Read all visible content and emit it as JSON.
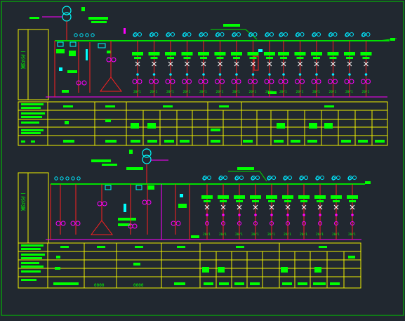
{
  "drawing": {
    "title": "",
    "colors": {
      "background": "#212830",
      "bus": "#00e000",
      "feeder": "#ff2020",
      "table_grid": "#f0f000",
      "label": "#00ff00",
      "breaker": "#ff00ff",
      "instrument": "#00e8ff",
      "transformer": "#00ffff",
      "border": "#00cc00",
      "white": "#ffffff"
    },
    "top_panel": {
      "side_label": "一次方案",
      "feeder_tag": "20/1",
      "feeder_count_left": 9,
      "feeder_count_right": 6
    },
    "bottom_panel": {
      "side_label": "一次方案",
      "feeder_tag": "20/1",
      "feeder_count": 10,
      "footer_left": "0000",
      "footer_right": "0000"
    }
  }
}
